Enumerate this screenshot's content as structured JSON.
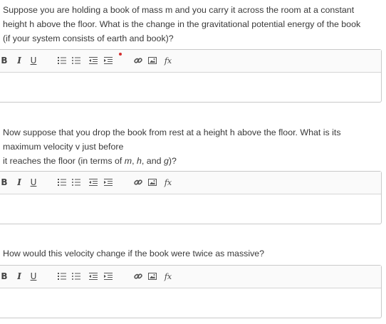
{
  "questions": [
    {
      "text_lines": [
        "Suppose you are holding a book of mass m and you carry it across the room at a constant",
        "height h above the floor. What is the change in the gravitational potential energy of the book",
        "(if your system consists of earth and book)?"
      ]
    },
    {
      "line1": "Now suppose that you drop the book from rest at a height h above the floor. What is its",
      "line2": "maximum velocity v just before",
      "line3_prefix": "it reaches the floor (in terms of ",
      "var_m": "m",
      "sep1": ", ",
      "var_h": "h",
      "sep2": ", and ",
      "var_g": "g",
      "line3_suffix": ")?"
    },
    {
      "text_lines": [
        "How would this velocity change if the book were twice as massive?"
      ]
    }
  ],
  "toolbar": {
    "bold": "B",
    "italic": "I",
    "underline": "U",
    "formula": "fx",
    "icons": [
      "ordered-list-icon",
      "unordered-list-icon",
      "outdent-icon",
      "indent-icon",
      "link-icon",
      "image-icon",
      "formula-icon"
    ]
  },
  "colors": {
    "text": "#3a3a3a",
    "border": "#c9c9c9",
    "toolbar_bg": "#fafafa",
    "red_indicator": "#d32f2f"
  }
}
